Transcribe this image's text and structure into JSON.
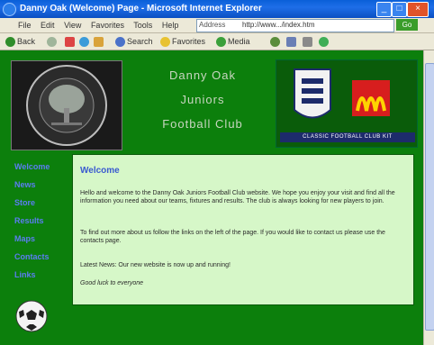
{
  "window": {
    "title": "Danny Oak (Welcome) Page - Microsoft Internet Explorer"
  },
  "menu": {
    "items": [
      "File",
      "Edit",
      "View",
      "Favorites",
      "Tools",
      "Help"
    ],
    "address_label": "Address",
    "address_value": "http://www.../index.htm",
    "go_label": "Go"
  },
  "toolbar": {
    "back_label": "Back",
    "search_label": "Search",
    "favorites_label": "Favorites",
    "media_label": "Media"
  },
  "site": {
    "title_lines": [
      "Danny Oak",
      "Juniors",
      "Football Club"
    ],
    "sponsor_banner": "CLASSIC FOOTBALL CLUB KIT",
    "nav": [
      "Welcome",
      "News",
      "Store",
      "Results",
      "Maps",
      "Contacts",
      "Links"
    ]
  },
  "content": {
    "heading": "Welcome",
    "para1": "Hello and welcome to the Danny Oak Juniors Football Club website. We hope you enjoy your visit and find all the information you need about our teams, fixtures and results. The club is always looking for new players to join.",
    "para2": "To find out more about us follow the links on the left of the page. If you would like to contact us please use the contacts page.",
    "para3": "Latest News: Our new website is now up and running!",
    "para4": "Good luck to everyone"
  }
}
